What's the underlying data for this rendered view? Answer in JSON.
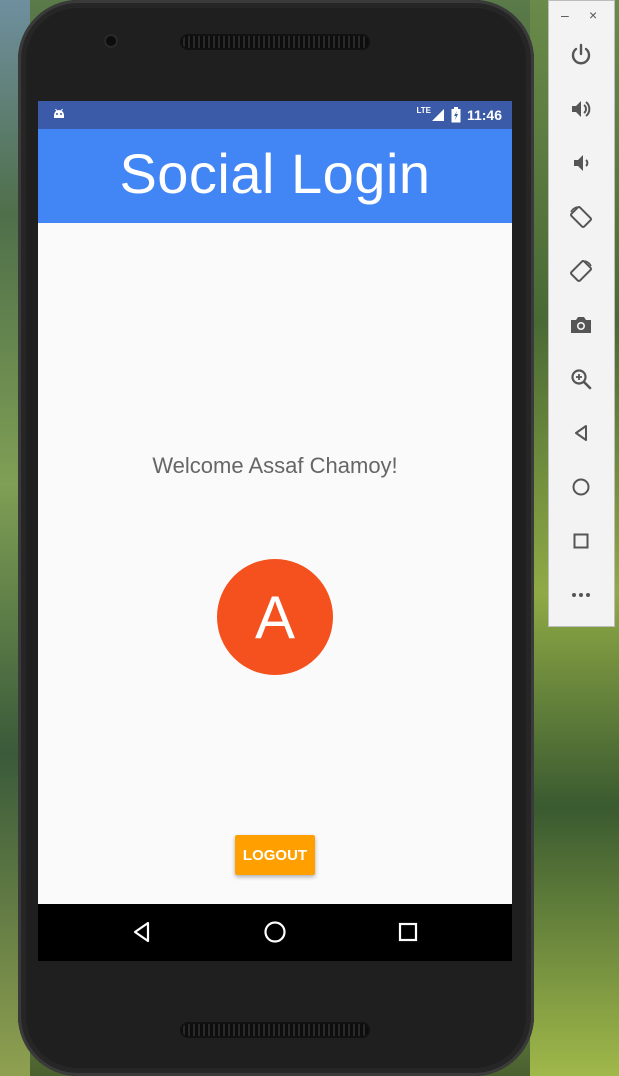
{
  "status_bar": {
    "network": "LTE",
    "time": "11:46"
  },
  "app_bar": {
    "title": "Social Login"
  },
  "main": {
    "welcome_text": "Welcome Assaf Chamoy!",
    "avatar_letter": "A",
    "logout_label": "LOGOUT"
  },
  "colors": {
    "status_bar": "#3b5ba9",
    "app_bar": "#4285f4",
    "avatar": "#f4511e",
    "logout_button": "#ffa000"
  },
  "nav_bar": {
    "icons": [
      "back-icon",
      "home-icon",
      "recents-icon"
    ]
  },
  "emulator_toolbar": {
    "window_controls": [
      "–",
      "×"
    ],
    "icons": [
      "power-icon",
      "volume-up-icon",
      "volume-down-icon",
      "rotate-left-icon",
      "rotate-right-icon",
      "camera-icon",
      "zoom-icon",
      "back-icon",
      "home-icon",
      "overview-icon",
      "more-icon"
    ]
  }
}
